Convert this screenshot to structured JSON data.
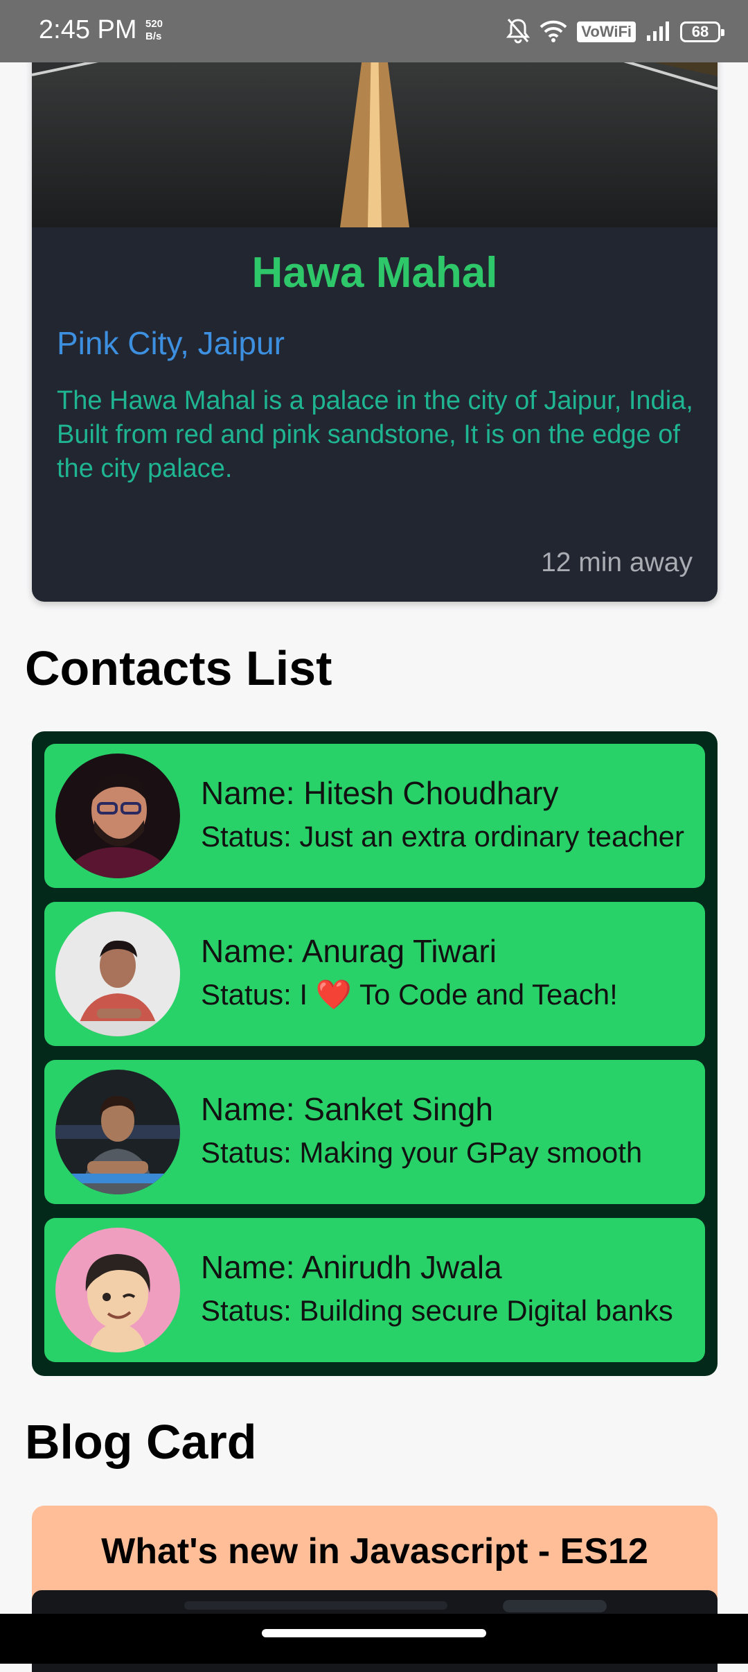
{
  "status_bar": {
    "time": "2:45 PM",
    "net_speed_value": "520",
    "net_speed_unit": "B/s",
    "vowifi_label": "VoWiFi",
    "battery_level": "68"
  },
  "place_card": {
    "title": "Hawa Mahal",
    "subtitle": "Pink City, Jaipur",
    "description": "The Hawa Mahal is a palace in the city of Jaipur, India, Built from red and pink sandstone, It is on the edge of the city palace.",
    "distance": "12 min away"
  },
  "contacts_section": {
    "heading": "Contacts List",
    "items": [
      {
        "name": "Name: Hitesh Choudhary",
        "status": "Status: Just an extra ordinary teacher"
      },
      {
        "name": "Name: Anurag Tiwari",
        "status": "Status: I ❤️ To Code and Teach!"
      },
      {
        "name": "Name: Sanket Singh",
        "status": "Status: Making your GPay smooth"
      },
      {
        "name": "Name: Anirudh Jwala",
        "status": "Status: Building secure Digital banks"
      }
    ]
  },
  "blog_section": {
    "heading": "Blog Card",
    "title": "What's new in Javascript - ES12"
  },
  "colors": {
    "place_title": "#2ec76a",
    "place_subtitle": "#3d8fe0",
    "place_description": "#1fb593",
    "contact_card": "#29d269",
    "contacts_container": "#02291a",
    "blog_card": "#ffbe97"
  }
}
